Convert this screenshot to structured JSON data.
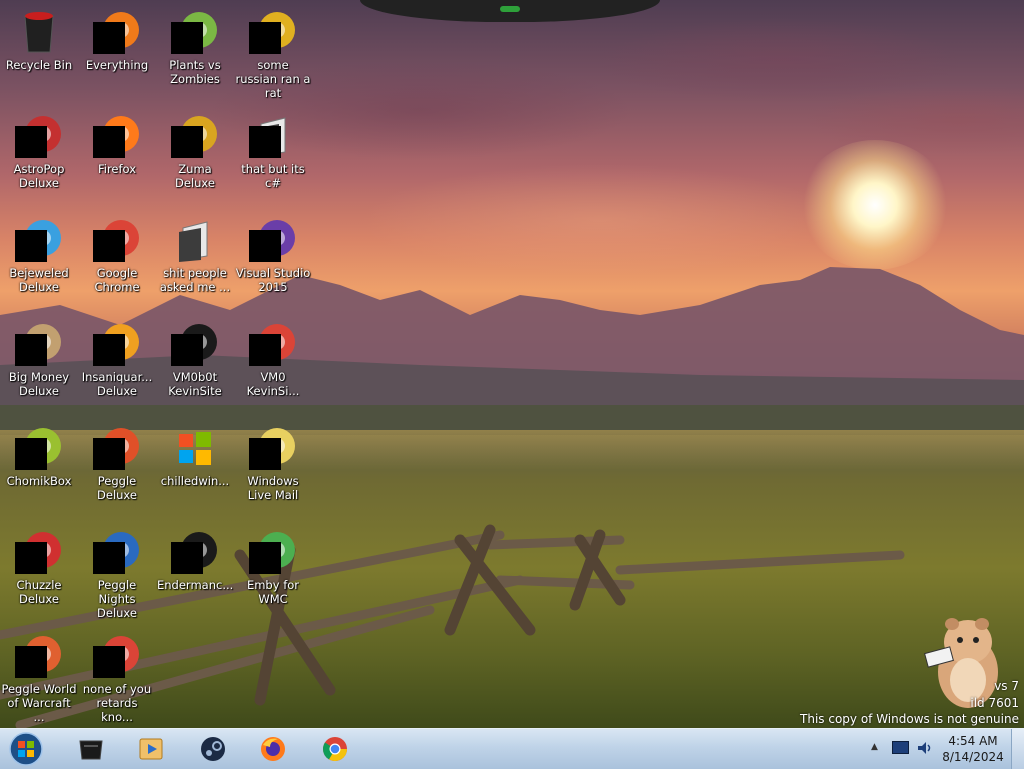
{
  "desktop": {
    "icons": [
      {
        "label": "Recycle Bin",
        "icon": "recycle-bin-icon",
        "redacted": false
      },
      {
        "label": "Everything",
        "icon": "everything-search-icon",
        "redacted": true
      },
      {
        "label": "Plants vs Zombies",
        "icon": "plants-vs-zombies-icon",
        "redacted": true
      },
      {
        "label": "some russian ran a rat",
        "icon": "document-icon",
        "redacted": true
      },
      {
        "label": "AstroPop Deluxe",
        "icon": "astropop-icon",
        "redacted": true
      },
      {
        "label": "Firefox",
        "icon": "firefox-icon",
        "redacted": true
      },
      {
        "label": "Zuma Deluxe",
        "icon": "zuma-icon",
        "redacted": true
      },
      {
        "label": "that but its c#",
        "icon": "folder-icon",
        "redacted": true
      },
      {
        "label": "Bejeweled Deluxe",
        "icon": "bejeweled-icon",
        "redacted": true
      },
      {
        "label": "Google Chrome",
        "icon": "chrome-icon",
        "redacted": true
      },
      {
        "label": "shit people asked me ...",
        "icon": "folder-icon",
        "redacted": false
      },
      {
        "label": "Visual Studio 2015",
        "icon": "visual-studio-icon",
        "redacted": true
      },
      {
        "label": "Big Money Deluxe",
        "icon": "big-money-icon",
        "redacted": true
      },
      {
        "label": "Insaniquar... Deluxe",
        "icon": "insaniquarium-icon",
        "redacted": true
      },
      {
        "label": "VM0b0t KevinSite",
        "icon": "terminal-icon",
        "redacted": true
      },
      {
        "label": "VM0 KevinSi...",
        "icon": "chrome-icon",
        "redacted": true
      },
      {
        "label": "ChomikBox",
        "icon": "chomikbox-icon",
        "redacted": true
      },
      {
        "label": "Peggle Deluxe",
        "icon": "peggle-icon",
        "redacted": true
      },
      {
        "label": "chilledwin...",
        "icon": "windows-logo-icon",
        "redacted": false
      },
      {
        "label": "Windows Live Mail",
        "icon": "mail-icon",
        "redacted": true
      },
      {
        "label": "Chuzzle Deluxe",
        "icon": "chuzzle-icon",
        "redacted": true
      },
      {
        "label": "Peggle Nights Deluxe",
        "icon": "peggle-nights-icon",
        "redacted": true
      },
      {
        "label": "Endermanc...",
        "icon": "terminal-icon",
        "redacted": true
      },
      {
        "label": "Emby for WMC",
        "icon": "emby-icon",
        "redacted": true
      },
      {
        "label": "Peggle World of Warcraft ...",
        "icon": "peggle-wow-icon",
        "redacted": true
      },
      {
        "label": "none of you retards kno...",
        "icon": "chrome-icon",
        "redacted": true
      }
    ]
  },
  "watermark": {
    "line1": "vs 7",
    "line2": "ild 7601",
    "line3": "This copy of Windows is not genuine"
  },
  "taskbar": {
    "start_icon": "windows-orb-icon",
    "pinned": [
      {
        "name": "terminal",
        "icon": "terminal-icon"
      },
      {
        "name": "media-player",
        "icon": "media-player-icon"
      },
      {
        "name": "steam",
        "icon": "steam-icon"
      },
      {
        "name": "firefox",
        "icon": "firefox-icon"
      },
      {
        "name": "chrome",
        "icon": "chrome-icon"
      }
    ],
    "tray": {
      "show_hidden_icon": "up-arrow-icon",
      "time": "4:54 AM",
      "date": "8/14/2024"
    }
  },
  "colors": {
    "taskbar": "#bfd3e8",
    "sky_warm": "#eea06a",
    "grass": "#6f6a33"
  }
}
